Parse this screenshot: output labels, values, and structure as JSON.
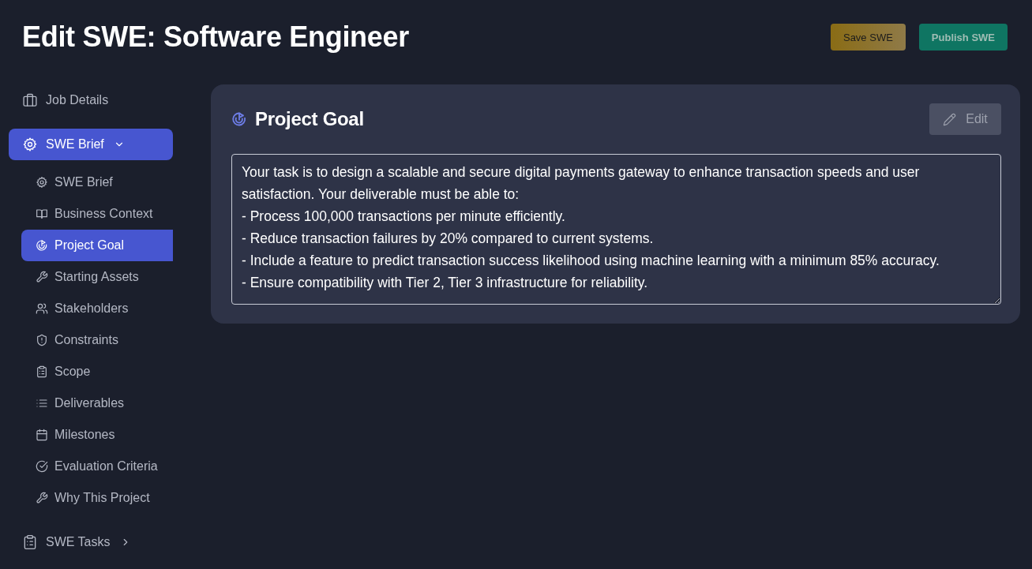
{
  "page": {
    "title": "Edit SWE: Software Engineer"
  },
  "header_buttons": [
    {
      "label": "Save SWE",
      "kind": "save"
    },
    {
      "label": "Publish SWE",
      "kind": "publish"
    }
  ],
  "sidebar": {
    "items": [
      {
        "label": "Job Details",
        "kind": "link",
        "selected": false
      },
      {
        "label": "SWE Brief",
        "kind": "group",
        "selected": true,
        "expanded": true,
        "children": [
          {
            "label": "SWE Brief",
            "selected": false
          },
          {
            "label": "Business Context",
            "selected": false
          },
          {
            "label": "Project Goal",
            "selected": true
          },
          {
            "label": "Starting Assets",
            "selected": false
          },
          {
            "label": "Stakeholders",
            "selected": false
          },
          {
            "label": "Constraints",
            "selected": false
          },
          {
            "label": "Scope",
            "selected": false
          },
          {
            "label": "Deliverables",
            "selected": false
          },
          {
            "label": "Milestones",
            "selected": false
          },
          {
            "label": "Evaluation Criteria",
            "selected": false
          },
          {
            "label": "Why This Project",
            "selected": false
          }
        ]
      },
      {
        "label": "SWE Tasks",
        "kind": "group",
        "selected": false,
        "expanded": false
      }
    ]
  },
  "section": {
    "title": "Project Goal",
    "edit_button": {
      "label": "Edit"
    },
    "goal_text": "Your task is to design a scalable and secure digital payments gateway to enhance transaction speeds and user satisfaction. Your deliverable must be able to:\n- Process 100,000 transactions per minute efficiently.\n- Reduce transaction failures by 20% compared to current systems.\n- Include a feature to predict transaction success likelihood using machine learning with a minimum 85% accuracy.\n- Ensure compatibility with Tier 2, Tier 3 infrastructure for reliability."
  }
}
